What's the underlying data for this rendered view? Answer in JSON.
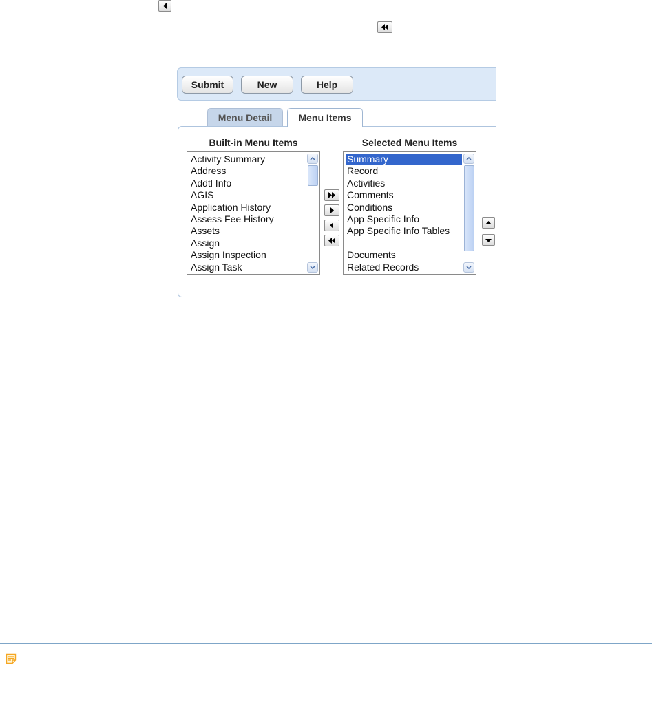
{
  "toolbar": {
    "submit_label": "Submit",
    "new_label": "New",
    "help_label": "Help"
  },
  "tabs": {
    "menu_detail": "Menu Detail",
    "menu_items": "Menu Items",
    "active": "Menu Items"
  },
  "builtin": {
    "header": "Built-in Menu Items",
    "items": [
      "Activity Summary",
      "Address",
      "Addtl Info",
      "AGIS",
      "Application History",
      "Assess Fee History",
      "Assets",
      "Assign",
      "Assign Inspection",
      "Assign Task"
    ]
  },
  "selected": {
    "header": "Selected Menu Items",
    "selected_item": "Summary",
    "items": [
      "Summary",
      "Record",
      "Activities",
      "Comments",
      "Conditions",
      "App Specific Info",
      "App Specific Info Tables",
      "",
      "Documents",
      "Related Records"
    ]
  },
  "icons": {
    "top_prev": "triangle-left-icon",
    "top_first": "double-left-icon",
    "move_all_right": "double-right-icon",
    "move_right": "triangle-right-icon",
    "move_left": "triangle-left-icon",
    "move_all_left": "double-left-icon",
    "move_up": "triangle-up-icon",
    "move_down": "triangle-down-icon",
    "note": "note-icon"
  },
  "colors": {
    "toolbar_bg": "#dce9f8",
    "selection": "#3366cc",
    "separator": "#7fa6c8",
    "note_icon": "#f5a623"
  }
}
